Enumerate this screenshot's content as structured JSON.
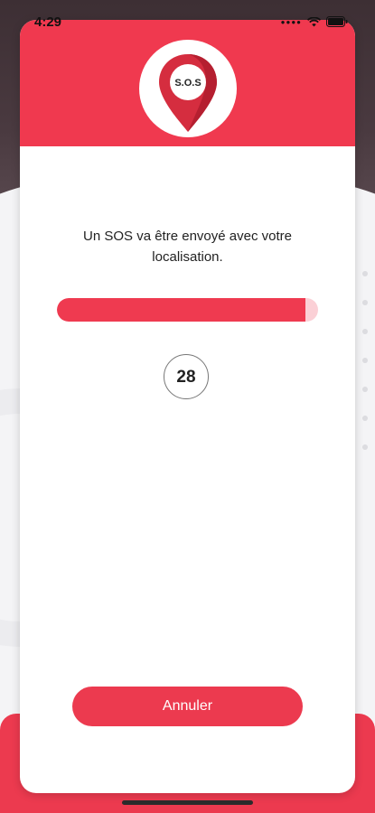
{
  "status_bar": {
    "time": "4:29"
  },
  "header": {
    "logo_text": "S.O.S",
    "logo_icon": "location-pin-icon",
    "color": "#f0394f"
  },
  "message": "Un SOS va être envoyé avec votre localisation.",
  "progress": {
    "fraction": 0.95
  },
  "countdown": "28",
  "actions": {
    "cancel_label": "Annuler"
  },
  "colors": {
    "accent": "#ec3a4f",
    "progress_track": "#fbd0d6"
  }
}
